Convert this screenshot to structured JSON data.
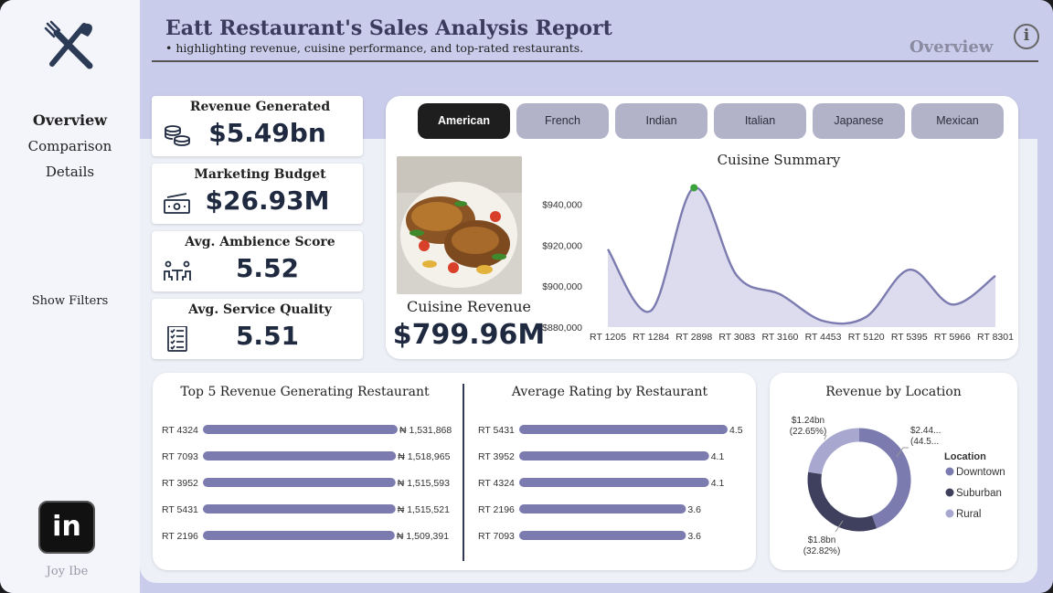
{
  "sidebar": {
    "nav": [
      "Overview",
      "Comparison",
      "Details"
    ],
    "show_filters": "Show Filters",
    "linkedin": "in",
    "author": "Joy Ibe"
  },
  "header": {
    "title": "Eatt Restaurant's Sales Analysis Report",
    "subtitle": "• highlighting revenue, cuisine performance, and top-rated restaurants.",
    "page_label": "Overview",
    "info": "i"
  },
  "kpis": [
    {
      "label": "Revenue Generated",
      "value": "$5.49bn",
      "icon": "coins-icon"
    },
    {
      "label": "Marketing Budget",
      "value": "$26.93M",
      "icon": "cash-icon"
    },
    {
      "label": "Avg.  Ambience Score",
      "value": "5.52",
      "icon": "dining-icon"
    },
    {
      "label": "Avg. Service Quality",
      "value": "5.51",
      "icon": "checklist-icon"
    }
  ],
  "cuisine": {
    "tabs": [
      "American",
      "French",
      "Indian",
      "Italian",
      "Japanese",
      "Mexican"
    ],
    "active_tab": "American",
    "revenue_label": "Cuisine Revenue",
    "revenue_value": "$799.96M"
  },
  "colors": {
    "accent": "#7b7bb0",
    "area_fill": "#dcdcee",
    "highlight": "#3aa33a",
    "downtown": "#7b7bb0",
    "suburban": "#3f3f5e",
    "rural": "#a7a7cf"
  },
  "chart_data": [
    {
      "type": "area",
      "title": "Cuisine Summary",
      "categories": [
        "RT 1205",
        "RT 1284",
        "RT 2898",
        "RT 3083",
        "RT 3160",
        "RT 4453",
        "RT 5120",
        "RT 5395",
        "RT 5966",
        "RT 8301"
      ],
      "values": [
        918000,
        888000,
        948000,
        905000,
        896000,
        883000,
        885000,
        908000,
        891000,
        905000
      ],
      "highlight_index": 2,
      "ylim": [
        880000,
        950000
      ],
      "yticks": [
        880000,
        900000,
        920000,
        940000
      ],
      "ytick_labels": [
        "$880,000",
        "$900,000",
        "$920,000",
        "$940,000"
      ],
      "grid": false
    },
    {
      "type": "bar",
      "orientation": "horizontal",
      "title": "Top 5 Revenue Generating Restaurant",
      "categories": [
        "RT 4324",
        "RT 7093",
        "RT 3952",
        "RT 5431",
        "RT 2196"
      ],
      "values": [
        1531868,
        1518965,
        1515593,
        1515521,
        1509391
      ],
      "value_labels": [
        "₦ 1,531,868",
        "₦ 1,518,965",
        "₦ 1,515,593",
        "₦ 1,515,521",
        "₦ 1,509,391"
      ],
      "xlim": [
        0,
        1531868
      ]
    },
    {
      "type": "bar",
      "orientation": "horizontal",
      "title": "Average Rating by Restaurant",
      "categories": [
        "RT 5431",
        "RT 3952",
        "RT 4324",
        "RT 2196",
        "RT 7093"
      ],
      "values": [
        4.5,
        4.1,
        4.1,
        3.6,
        3.6
      ],
      "value_labels": [
        "4.5",
        "4.1",
        "4.1",
        "3.6",
        "3.6"
      ],
      "xlim": [
        0,
        4.5
      ]
    },
    {
      "type": "pie",
      "style": "donut",
      "title": "Revenue by Location",
      "legend_title": "Location",
      "legend_position": "right",
      "labels": [
        "Downtown",
        "Suburban",
        "Rural"
      ],
      "values": [
        2.44,
        1.8,
        1.24
      ],
      "percents": [
        44.53,
        32.82,
        22.65
      ],
      "slice_labels": [
        [
          "$2.44...",
          "(44.5..."
        ],
        [
          "$1.8bn",
          "(32.82%)"
        ],
        [
          "$1.24bn",
          "(22.65%)"
        ]
      ]
    }
  ]
}
